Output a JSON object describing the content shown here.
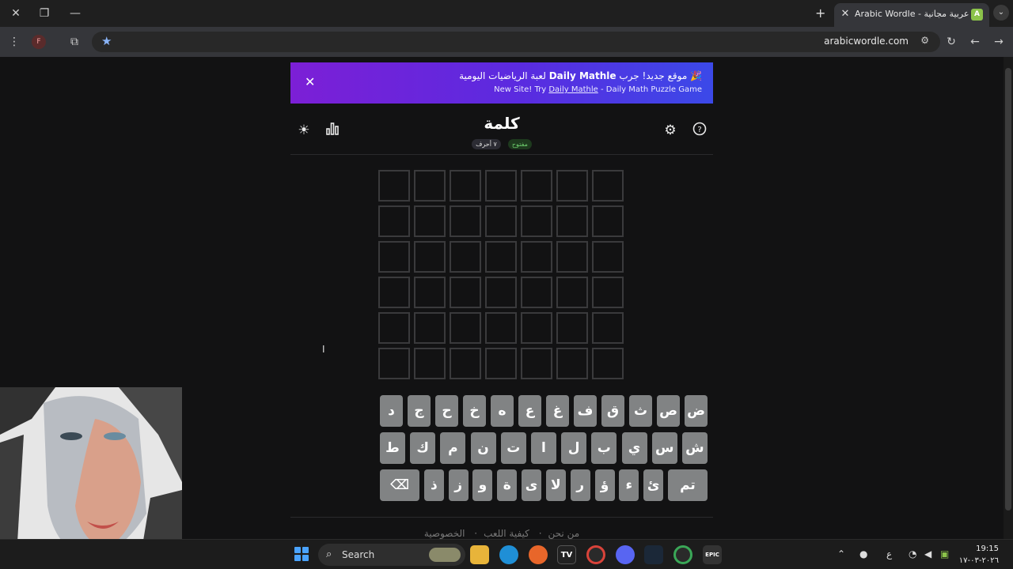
{
  "browser": {
    "tab_title": "Arabic Wordle - كلمة | ألعاب كلمات عربية مجانية",
    "tab_favicon": "A",
    "url": "arabicwordle.com",
    "profile_initial": "F"
  },
  "banner": {
    "line1_prefix": "🎉 موقع جديد! جرب ",
    "line1_link": "Daily Mathle",
    "line1_suffix": " لعبة الرياضيات اليومية",
    "line2_prefix": "New Site! Try ",
    "line2_link": "Daily Mathle",
    "line2_suffix": " - Daily Math Puzzle Game",
    "close": "✕"
  },
  "header": {
    "title": "كلمة",
    "badge_open": "مفتوح",
    "badge_letters": "٧ أحرف"
  },
  "keyboard": {
    "row1": [
      "ض",
      "ص",
      "ث",
      "ق",
      "ف",
      "غ",
      "ع",
      "ه",
      "خ",
      "ح",
      "ج",
      "د"
    ],
    "row2": [
      "ش",
      "س",
      "ي",
      "ب",
      "ل",
      "ا",
      "ت",
      "ن",
      "م",
      "ك",
      "ط"
    ],
    "row3": [
      "تم",
      "ئ",
      "ء",
      "ؤ",
      "ر",
      "لا",
      "ى",
      "ة",
      "و",
      "ز",
      "ذ",
      "⌫"
    ]
  },
  "footer": {
    "links": [
      "من نحن",
      "كيفية اللعب",
      "الخصوصية"
    ]
  },
  "taskbar": {
    "search_label": "Search",
    "tray_lang": "ع",
    "time": "19:15",
    "date": "٢٠٢٦-٠٣-١٧"
  }
}
